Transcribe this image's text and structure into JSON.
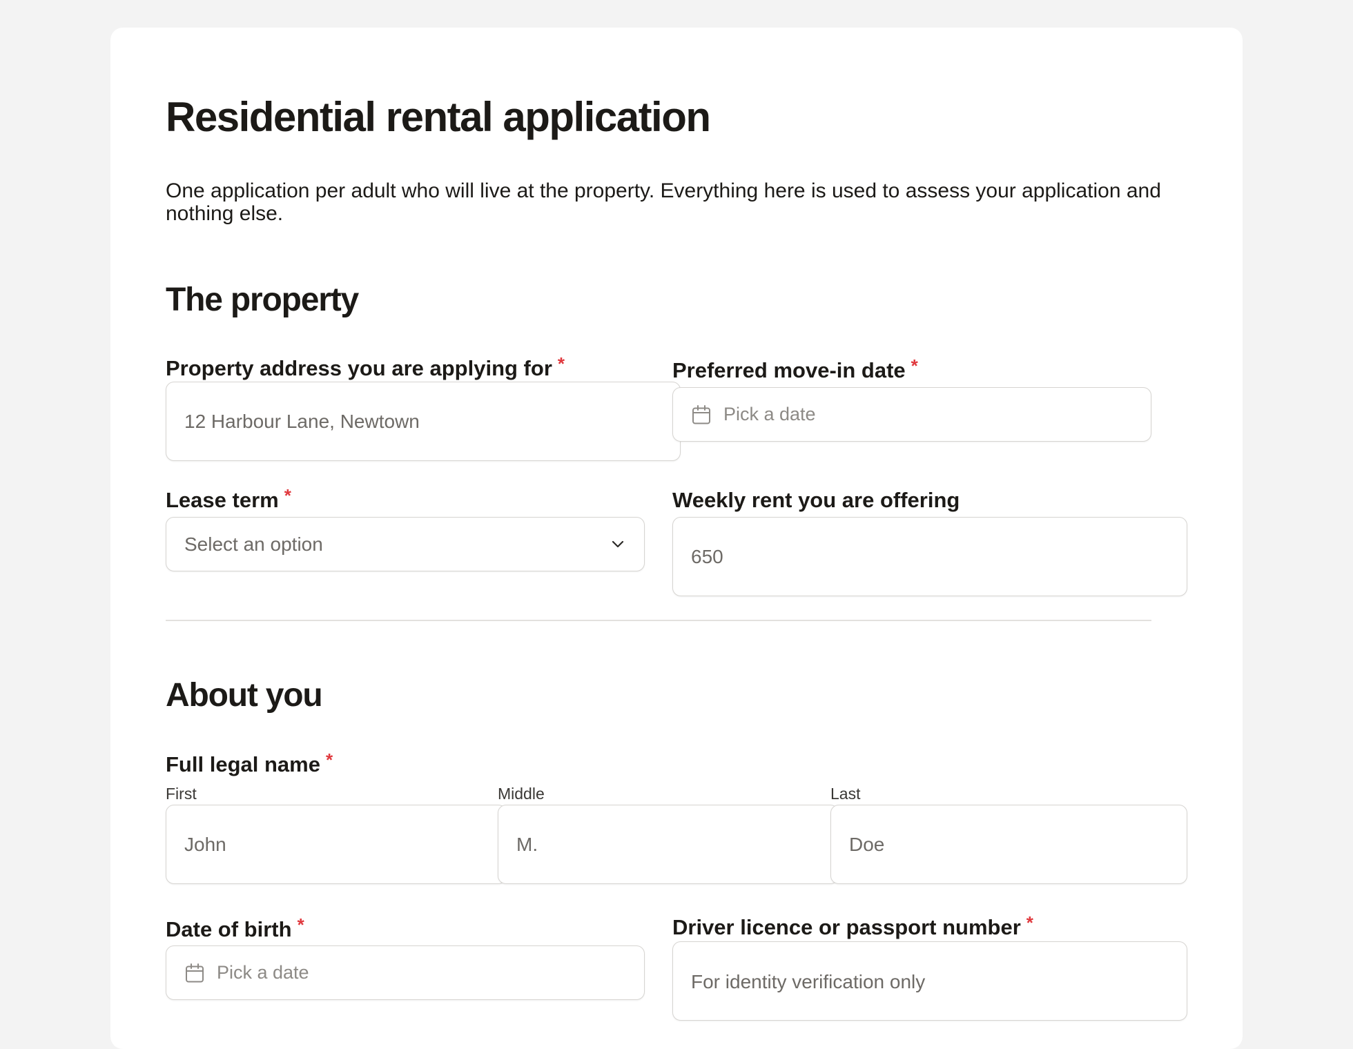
{
  "form": {
    "title": "Residential rental application",
    "intro": "One application per adult who will live at the property. Everything here is used to assess your application and nothing else.",
    "required_marker": "*"
  },
  "property_section": {
    "heading": "The property",
    "address": {
      "label": "Property address you are applying for",
      "placeholder": "12 Harbour Lane, Newtown",
      "required": true
    },
    "move_in": {
      "label": "Preferred move-in date",
      "placeholder": "Pick a date",
      "required": true
    },
    "lease_term": {
      "label": "Lease term",
      "placeholder": "Select an option",
      "required": true
    },
    "weekly_rent": {
      "label": "Weekly rent you are offering",
      "placeholder": "650",
      "required": false
    }
  },
  "about_section": {
    "heading": "About you",
    "full_name": {
      "label": "Full legal name",
      "required": true,
      "first": {
        "sublabel": "First",
        "placeholder": "John"
      },
      "middle": {
        "sublabel": "Middle",
        "placeholder": "M."
      },
      "last": {
        "sublabel": "Last",
        "placeholder": "Doe"
      }
    },
    "dob": {
      "label": "Date of birth",
      "placeholder": "Pick a date",
      "required": true
    },
    "id_number": {
      "label": "Driver licence or passport number",
      "placeholder": "For identity verification only",
      "required": true
    }
  },
  "icons": {
    "date": "calendar-icon",
    "select": "chevron-down-icon"
  },
  "colors": {
    "page_background": "#f3f3f3",
    "card_background": "#ffffff",
    "text": "#1c1a17",
    "required_asterisk": "#e0393e",
    "field_border": "#d6d4d1",
    "placeholder": "#6d6a66"
  }
}
